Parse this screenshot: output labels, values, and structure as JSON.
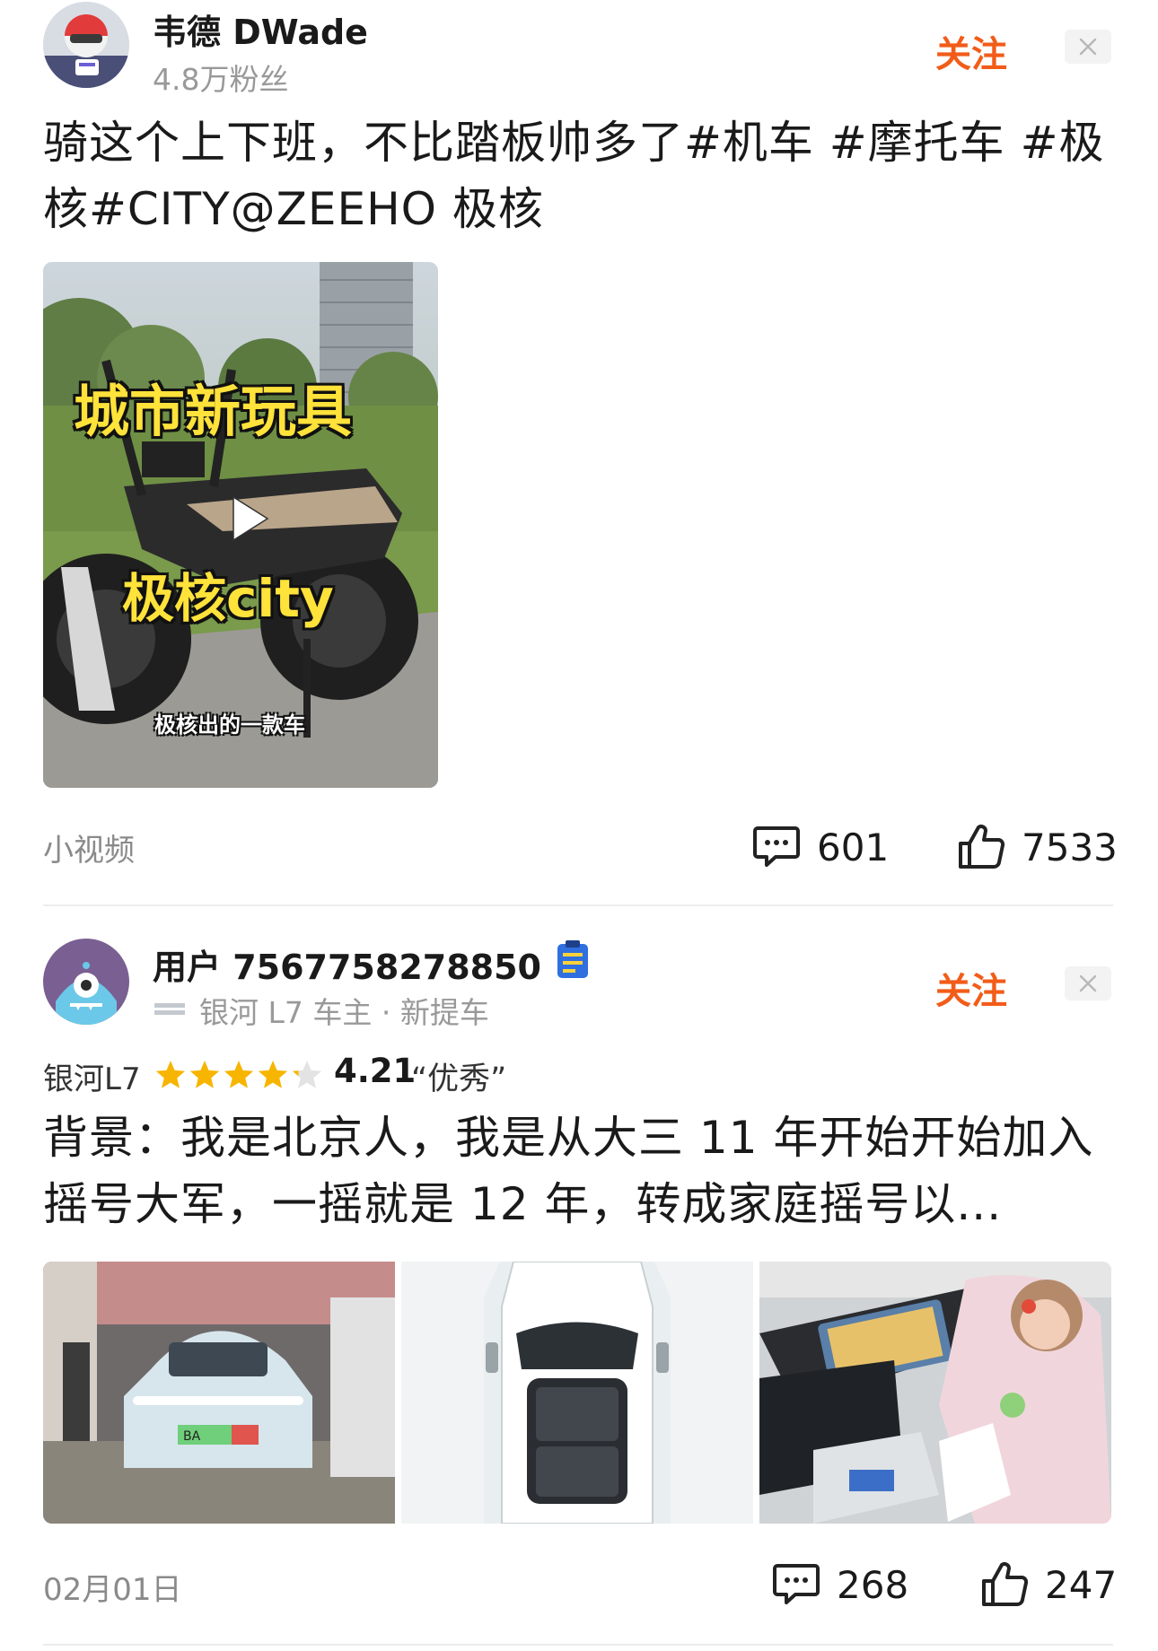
{
  "post1": {
    "author": "韦德 DWade",
    "fans": "4.8万粉丝",
    "follow_label": "关注",
    "text": "骑这个上下班，不比踏板帅多了#机车 #摩托车 #极核#CITY@ZEEHO 极核",
    "video": {
      "caption_big_1": "城市新玩具",
      "caption_big_2": "极核city",
      "caption_small": "极核出的一款车"
    },
    "type_label": "小视频",
    "comments": "601",
    "likes": "7533"
  },
  "post2": {
    "author": "用户 7567758278850",
    "subtitle": "银河 L7 车主 · 新提车",
    "follow_label": "关注",
    "car_model": "银河L7",
    "rating": 4.21,
    "rating_text": "4.21",
    "rating_word": "“优秀”",
    "text": "背景：我是北京人，我是从大三 11 年开始开始加入摇号大军，一摇就是 12 年，转成家庭摇号以...",
    "plate_text": "BA",
    "date": "02月01日",
    "comments": "268",
    "likes": "247"
  },
  "icons": {
    "comment": "comment-bubble-icon",
    "like": "thumbs-up-icon",
    "close": "close-icon",
    "play": "play-icon",
    "badge": "clipboard-badge-icon",
    "star": "star-icon"
  },
  "colors": {
    "follow": "#f25c19",
    "star": "#f7b500",
    "star_empty": "#e3e3e3",
    "secondary_text": "#999999"
  }
}
